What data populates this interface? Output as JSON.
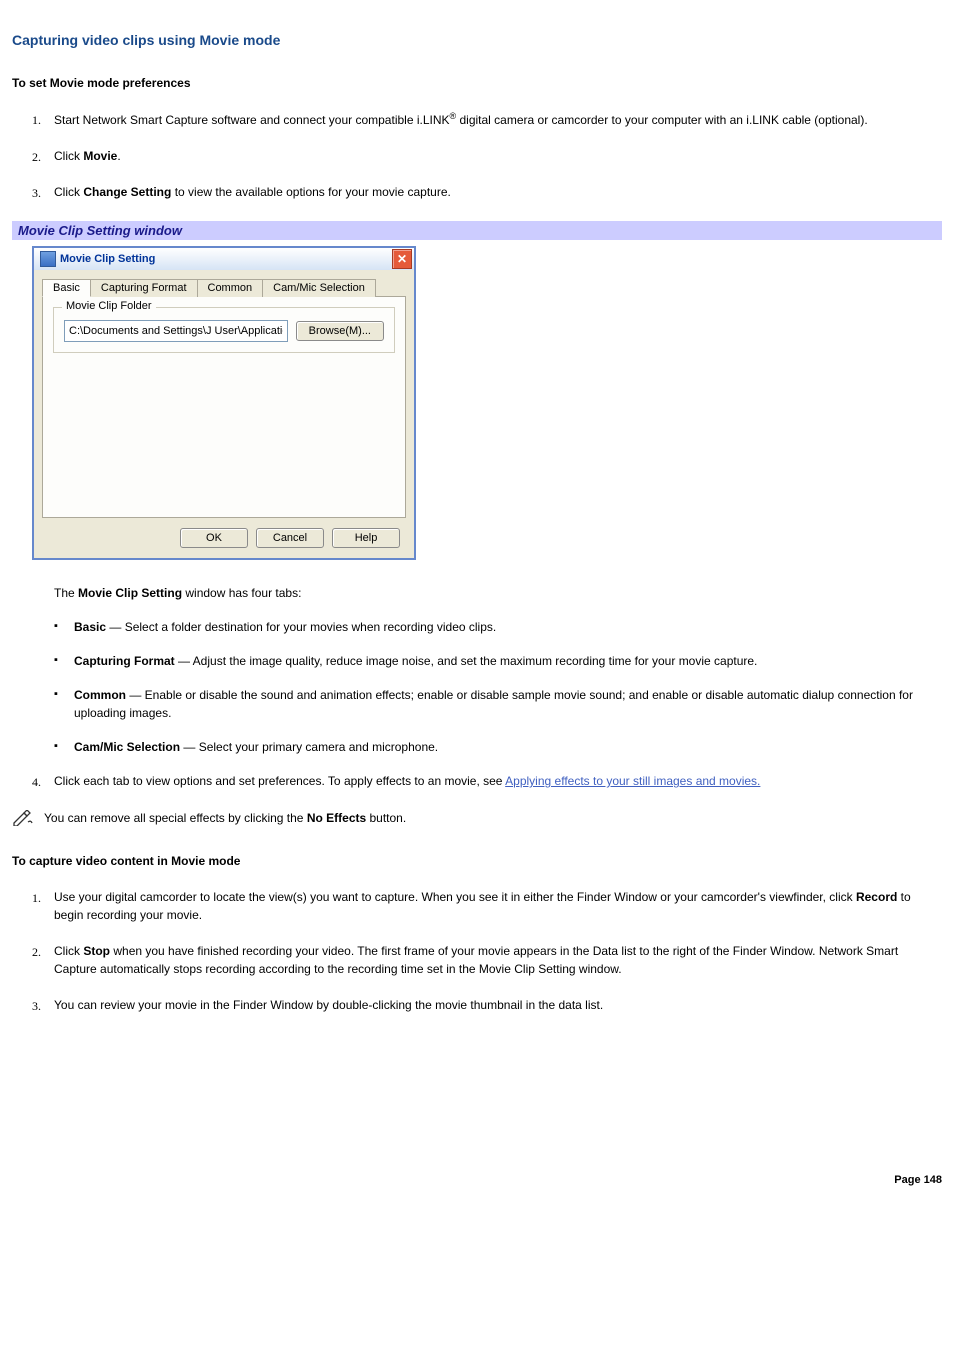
{
  "title": "Capturing video clips using Movie mode",
  "section1_heading": "To set Movie mode preferences",
  "steps1": {
    "s1_a": "Start Network Smart Capture software and connect your compatible i.LINK",
    "s1_sup": "®",
    "s1_b": " digital camera or camcorder to your computer with an i.LINK cable (optional).",
    "s2_a": "Click ",
    "s2_bold": "Movie",
    "s2_b": ".",
    "s3_a": "Click ",
    "s3_bold": "Change Setting",
    "s3_b": " to view the available options for your movie capture."
  },
  "caption": "Movie Clip Setting window",
  "dialog": {
    "title": "Movie Clip Setting",
    "tabs": [
      "Basic",
      "Capturing Format",
      "Common",
      "Cam/Mic Selection"
    ],
    "group_label": "Movie Clip Folder",
    "path": "C:\\Documents and Settings\\J User\\Application Data\\So",
    "browse": "Browse(M)...",
    "ok": "OK",
    "cancel": "Cancel",
    "help": "Help"
  },
  "tabs_intro_a": "The ",
  "tabs_intro_bold": "Movie Clip Setting",
  "tabs_intro_b": " window has four tabs:",
  "tablist": {
    "t1_bold": "Basic",
    "t1_rest": " — Select a folder destination for your movies when recording video clips.",
    "t2_bold": "Capturing Format",
    "t2_rest": " — Adjust the image quality, reduce image noise, and set the maximum recording time for your movie capture.",
    "t3_bold": "Common",
    "t3_rest": " — Enable or disable the sound and animation effects; enable or disable sample movie sound; and enable or disable automatic dialup connection for uploading images.",
    "t4_bold": "Cam/Mic Selection",
    "t4_rest": " — Select your primary camera and microphone."
  },
  "step4_a": "Click each tab to view options and set preferences. To apply effects to an movie, see ",
  "step4_link": "Applying effects to your still images and movies.",
  "note_a": "You can remove all special effects by clicking the ",
  "note_bold": "No Effects",
  "note_b": " button.",
  "section2_heading": "To capture video content in Movie mode",
  "steps2": {
    "s1_a": "Use your digital camcorder to locate the view(s) you want to capture. When you see it in either the Finder Window or your camcorder's viewfinder, click ",
    "s1_bold": "Record",
    "s1_b": " to begin recording your movie.",
    "s2_a": "Click ",
    "s2_bold": "Stop",
    "s2_b": " when you have finished recording your video. The first frame of your movie appears in the Data list to the right of the Finder Window. Network Smart Capture automatically stops recording according to the recording time set in the Movie Clip Setting window.",
    "s3": "You can review your movie in the Finder Window by double-clicking the movie thumbnail in the data list."
  },
  "page_number": "Page 148"
}
